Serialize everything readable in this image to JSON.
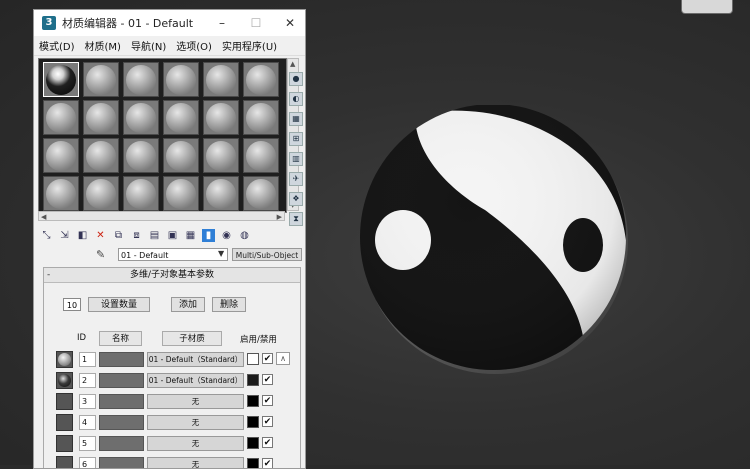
{
  "window": {
    "title": "材质编辑器 - 01 - Default",
    "icon_letter": "3",
    "controls": [
      "–",
      "☐",
      "✕"
    ]
  },
  "menu": [
    "模式(D)",
    "材质(M)",
    "导航(N)",
    "选项(O)",
    "实用程序(U)"
  ],
  "slots": {
    "rows": 4,
    "cols": 6,
    "selected_index": 0
  },
  "side_tools": [
    "sphere-sample-icon",
    "backlight-icon",
    "checker-background-icon",
    "uv-tiling-icon",
    "video-color-check-icon",
    "make-preview-icon",
    "options-icon",
    "select-by-material-icon"
  ],
  "toolbar_icons": [
    {
      "name": "get-material-icon",
      "glyph": "⤡"
    },
    {
      "name": "put-to-scene-icon",
      "glyph": "⇲"
    },
    {
      "name": "assign-to-selection-icon",
      "glyph": "◧"
    },
    {
      "name": "reset-map-icon",
      "glyph": "✕",
      "style": "red"
    },
    {
      "name": "make-copy-icon",
      "glyph": "⧉"
    },
    {
      "name": "make-unique-icon",
      "glyph": "⧈"
    },
    {
      "name": "put-to-library-icon",
      "glyph": "▤"
    },
    {
      "name": "material-id-channel-icon",
      "glyph": "▣"
    },
    {
      "name": "show-map-icon",
      "glyph": "▦"
    },
    {
      "name": "show-end-result-icon",
      "glyph": "▮",
      "style": "blue"
    },
    {
      "name": "go-to-parent-icon",
      "glyph": "◉"
    },
    {
      "name": "go-forward-icon",
      "glyph": "◍"
    }
  ],
  "material": {
    "name": "01 - Default",
    "type": "Multi/Sub-Object"
  },
  "rollout": {
    "title": "多维/子对象基本参数",
    "toggle": "-",
    "count": "10",
    "set_number_label": "设置数量",
    "add_label": "添加",
    "delete_label": "删除",
    "headers": {
      "id": "ID",
      "name": "名称",
      "submaterial": "子材质",
      "onoff": "启用/禁用"
    },
    "rows": [
      {
        "id": "1",
        "submaterial": "01 - Default（Standard）",
        "thumb": "filled",
        "swatch": "#ffffff",
        "checked": "✔"
      },
      {
        "id": "2",
        "submaterial": "01 - Default（Standard）",
        "thumb": "dark",
        "swatch": "#1a1a1a",
        "checked": "✔"
      },
      {
        "id": "3",
        "submaterial": "无",
        "thumb": "empty",
        "swatch": "#000000",
        "checked": "✔"
      },
      {
        "id": "4",
        "submaterial": "无",
        "thumb": "empty",
        "swatch": "#000000",
        "checked": "✔"
      },
      {
        "id": "5",
        "submaterial": "无",
        "thumb": "empty",
        "swatch": "#000000",
        "checked": "✔"
      },
      {
        "id": "6",
        "submaterial": "无",
        "thumb": "empty",
        "swatch": "#000000",
        "checked": "✔"
      }
    ],
    "row1_extra": "∧"
  }
}
